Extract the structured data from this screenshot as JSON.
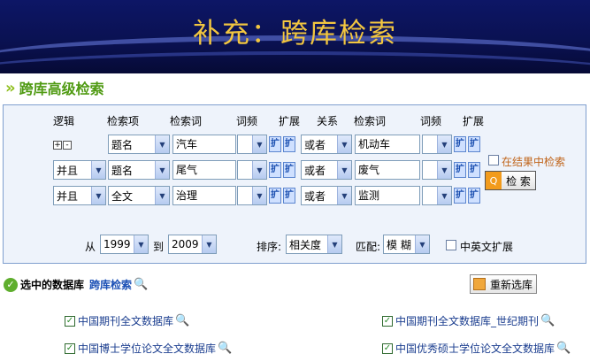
{
  "slide": {
    "title": "补充：跨库检索"
  },
  "section": {
    "title": "跨库高级检索",
    "chevron": "»"
  },
  "headers": {
    "logic": "逻辑",
    "field": "检索项",
    "term": "检索词",
    "freq": "词频",
    "expand": "扩展",
    "relation": "关系",
    "term2": "检索词",
    "freq2": "词频",
    "expand2": "扩展"
  },
  "rows": [
    {
      "logic": "",
      "field": "题名",
      "term": "汽车",
      "freq": "",
      "relation": "或者",
      "term2": "机动车",
      "freq2": ""
    },
    {
      "logic": "并且",
      "field": "题名",
      "term": "尾气",
      "freq": "",
      "relation": "或者",
      "term2": "废气",
      "freq2": ""
    },
    {
      "logic": "并且",
      "field": "全文",
      "term": "治理",
      "freq": "",
      "relation": "或者",
      "term2": "监测",
      "freq2": ""
    }
  ],
  "plus_minus": {
    "plus": "+",
    "minus": "-"
  },
  "search_in_results": "在结果中检索",
  "search_button": "检 索",
  "range": {
    "from_label": "从",
    "from": "1999",
    "to_label": "到",
    "to": "2009"
  },
  "sort": {
    "label": "排序:",
    "value": "相关度"
  },
  "match": {
    "label": "匹配:",
    "value": "模 糊"
  },
  "cn_en_expand": "中英文扩展",
  "databases": {
    "title": "选中的数据库",
    "link": "跨库检索",
    "reset_button": "重新选库",
    "items": [
      "中国期刊全文数据库",
      "中国期刊全文数据库_世纪期刊",
      "中国博士学位论文全文数据库",
      "中国优秀硕士学位论文全文数据库"
    ]
  },
  "colors": {
    "banner": "#0a1150",
    "title_gold": "#f2c640",
    "section_green": "#4f9a12",
    "panel_bg": "#eef3fb",
    "link_blue": "#1a4fb5"
  }
}
